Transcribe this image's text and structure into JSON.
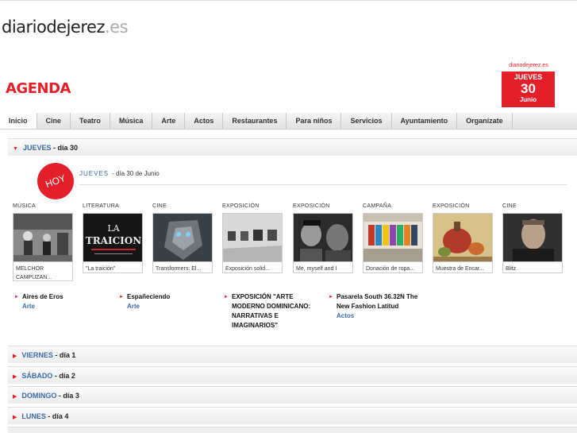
{
  "site": {
    "logo_main": "diariodejerez",
    "logo_ext": ".es"
  },
  "agenda": {
    "title": "AGENDA"
  },
  "date_widget": {
    "site": "diariodejerez.es",
    "weekday": "JUEVES",
    "day": "30",
    "month": "Junio"
  },
  "nav": {
    "tabs": [
      "Inicio",
      "Cine",
      "Teatro",
      "Música",
      "Arte",
      "Actos",
      "Restaurantes",
      "Para niños",
      "Servicios",
      "Ayuntamiento",
      "Organízate"
    ]
  },
  "today": {
    "day_name": "JUEVES",
    "day_num": " - día 30",
    "badge": "HOY",
    "line_day": "JUEVES",
    "line_text": "- día 30 de Junio"
  },
  "cards": [
    {
      "category": "MÚSICA",
      "caption": "MELCHOR CAMPUZAN...",
      "icon": "concert-photo"
    },
    {
      "category": "LITERATURA",
      "caption": "\"La traición\"",
      "icon": "book-cover-photo"
    },
    {
      "category": "CINE",
      "caption": "Transformers: El...",
      "icon": "robot-movie-photo"
    },
    {
      "category": "EXPOSICIÓN",
      "caption": "Exposición solid...",
      "icon": "gallery-photo"
    },
    {
      "category": "EXPOSICIÓN",
      "caption": "Me, myself and I",
      "icon": "portrait-photo"
    },
    {
      "category": "CAMPAÑA",
      "caption": "Donación de ropa...",
      "icon": "clothes-store-photo"
    },
    {
      "category": "EXPOSICIÓN",
      "caption": "Muestra de Encar...",
      "icon": "still-life-photo"
    },
    {
      "category": "CINE",
      "caption": "Blitz",
      "icon": "actor-photo"
    }
  ],
  "events": [
    {
      "title": "Aires de Eros",
      "section": "Arte"
    },
    {
      "title": "Españeciendo",
      "section": "Arte"
    },
    {
      "title": "EXPOSICIÓN \"ARTE MODERNO DOMINICANO: NARRATIVAS E IMAGINARIOS\"",
      "section": ""
    },
    {
      "title": "Pasarela South 36.32N The New Fashion Latitud",
      "section": "Actos"
    }
  ],
  "days": [
    {
      "name": "VIERNES",
      "num": " - día 1"
    },
    {
      "name": "SÁBADO",
      "num": " - día 2"
    },
    {
      "name": "DOMINGO",
      "num": " - día 3"
    },
    {
      "name": "LUNES",
      "num": " - día 4"
    }
  ],
  "colors": {
    "accent": "#e3202a",
    "link": "#3b69a8"
  }
}
